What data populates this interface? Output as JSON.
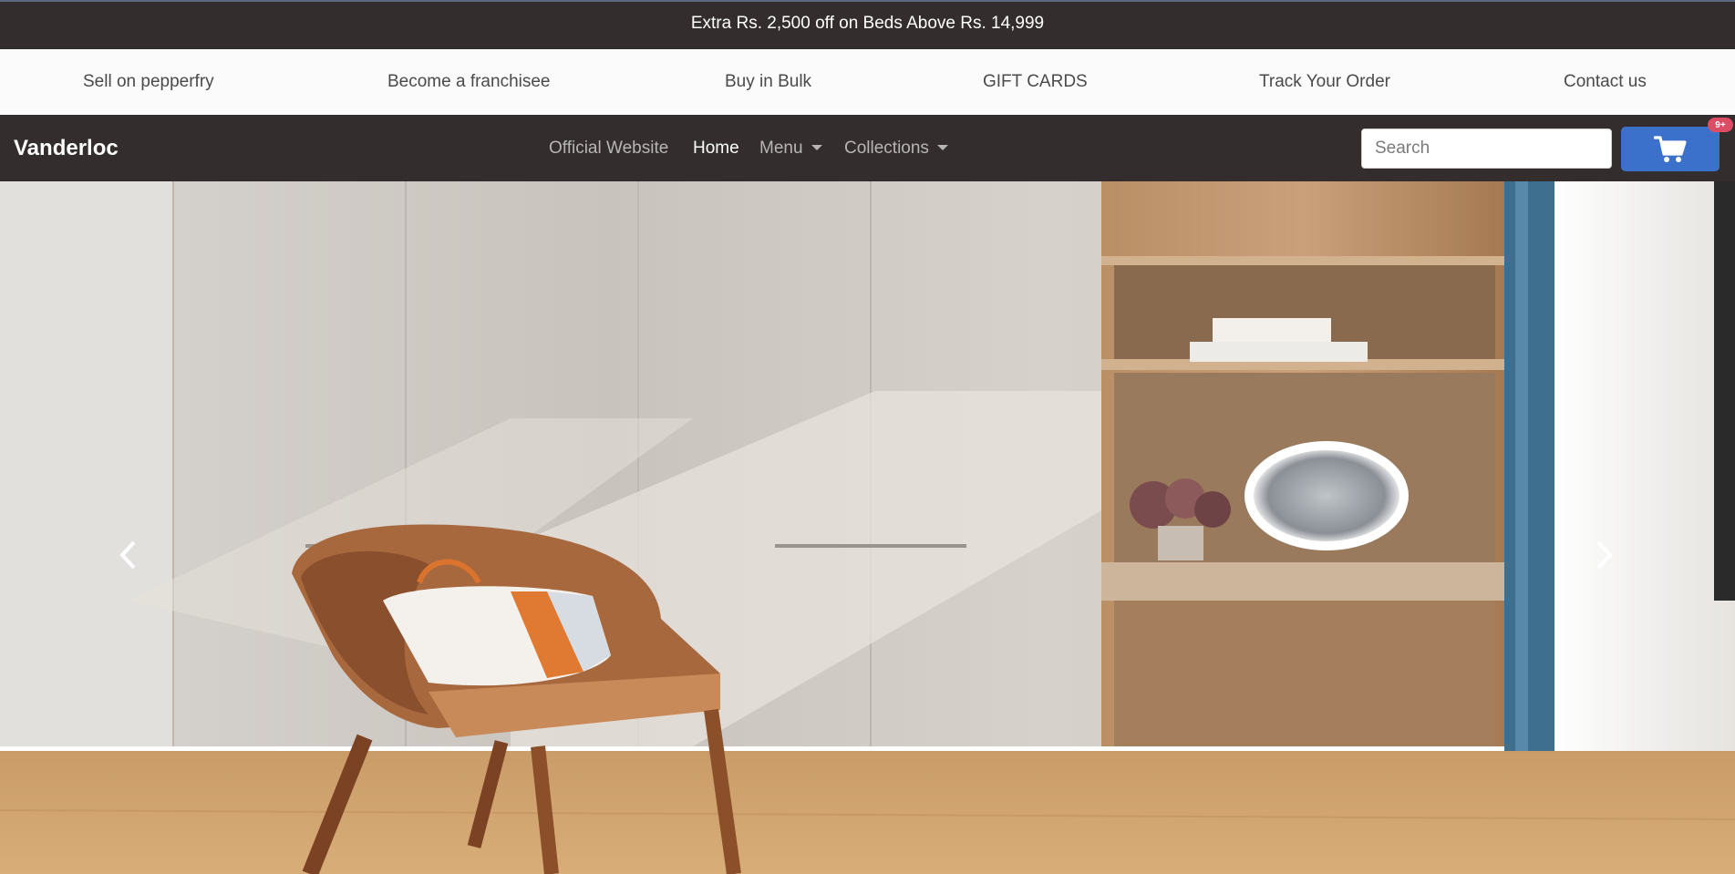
{
  "promo": {
    "text": "Extra Rs. 2,500 off on Beds Above Rs. 14,999"
  },
  "top_links": [
    {
      "label": "Sell on pepperfry"
    },
    {
      "label": "Become a franchisee"
    },
    {
      "label": "Buy in Bulk"
    },
    {
      "label": "GIFT CARDS"
    },
    {
      "label": "Track Your Order"
    },
    {
      "label": "Contact us"
    }
  ],
  "navbar": {
    "brand": "Vanderloc",
    "links": [
      {
        "label": "Official Website",
        "active": false
      },
      {
        "label": "Home",
        "active": true
      },
      {
        "label": "Menu",
        "dropdown": true
      },
      {
        "label": "Collections",
        "dropdown": true
      }
    ],
    "search": {
      "placeholder": "Search",
      "value": ""
    },
    "cart": {
      "icon": "shopping-cart-icon",
      "badge": "9+"
    }
  },
  "carousel": {
    "image": "bedroom-interior-chair-with-bag-and-wooden-shelves",
    "prev_icon": "chevron-left-icon",
    "next_icon": "chevron-right-icon"
  },
  "colors": {
    "dark_bar": "#332d2d",
    "links_bar": "#fbfbfb",
    "primary": "#3b71ca",
    "badge": "#dc4c64"
  }
}
